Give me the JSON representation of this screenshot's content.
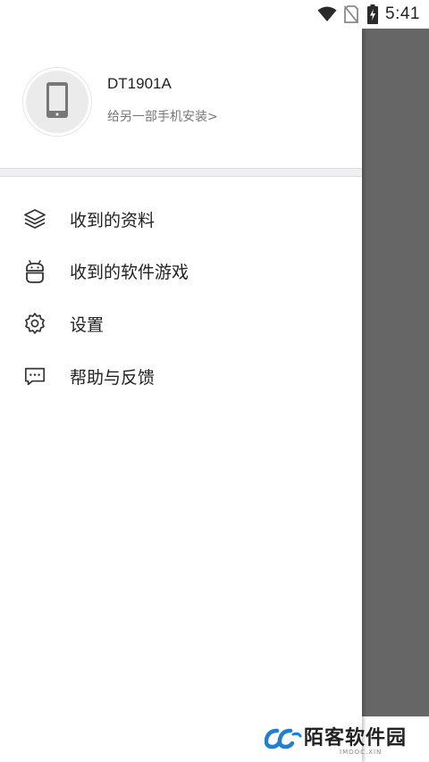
{
  "status_bar": {
    "time": "5:41",
    "icons": [
      "wifi-icon",
      "no-sim-icon",
      "battery-charging-icon"
    ]
  },
  "device": {
    "name": "DT1901A",
    "install_link": "给另一部手机安装>",
    "avatar_icon": "phone-icon"
  },
  "menu": {
    "items": [
      {
        "label": "收到的资料",
        "icon": "layers-icon"
      },
      {
        "label": "收到的软件游戏",
        "icon": "android-icon"
      },
      {
        "label": "设置",
        "icon": "gear-icon"
      },
      {
        "label": "帮助与反馈",
        "icon": "chat-bubble-icon"
      }
    ]
  },
  "watermark": {
    "text": "陌客软件园",
    "subtext": "IMOOC.XIN"
  },
  "colors": {
    "scrim": "#666666",
    "text_primary": "#222222",
    "text_secondary": "#777777",
    "divider": "#f0f0f4",
    "watermark_blue": "#1f7fd6"
  }
}
